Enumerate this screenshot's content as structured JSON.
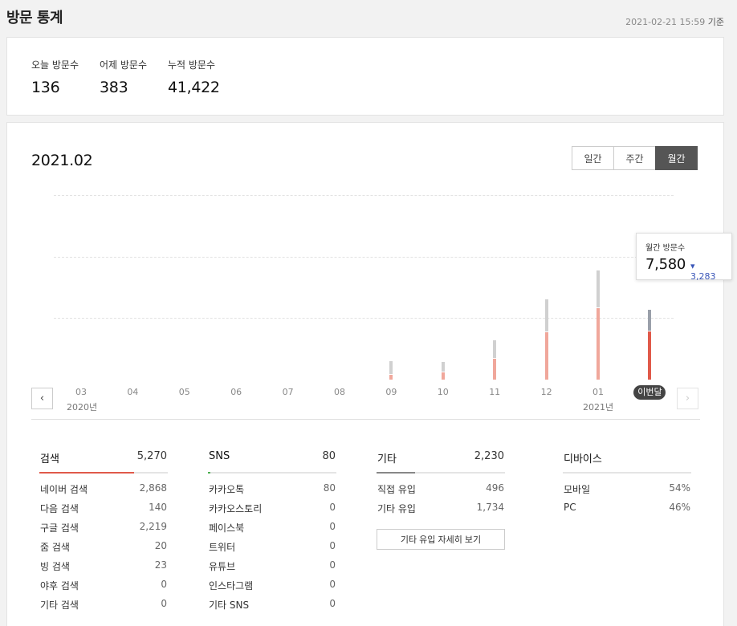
{
  "header": {
    "title": "방문 통계",
    "timestamp": "2021-02-21 15:59",
    "timestamp_suffix": "기준"
  },
  "summary": [
    {
      "label": "오늘 방문수",
      "value": "136"
    },
    {
      "label": "어제 방문수",
      "value": "383"
    },
    {
      "label": "누적 방문수",
      "value": "41,422"
    }
  ],
  "period": "2021.02",
  "tabs": [
    {
      "label": "일간"
    },
    {
      "label": "주간"
    },
    {
      "label": "월간",
      "active": true
    }
  ],
  "nav": {
    "prev": "‹",
    "next": "›"
  },
  "tooltip": {
    "label": "월간 방문수",
    "value": "7,580",
    "change": "3,283",
    "change_icon": "▾"
  },
  "year_labels": [
    "2020년",
    "2021년"
  ],
  "colors": {
    "new": "#f0a79b",
    "new_current": "#e05a4a",
    "prev": "#d0d0d0",
    "prev_current": "#9aa0aa",
    "search": "#e05a4a",
    "sns": "#4caf50",
    "etc": "#888888",
    "device": "#dddddd"
  },
  "chart_data": {
    "type": "bar",
    "categories": [
      "03",
      "04",
      "05",
      "06",
      "07",
      "08",
      "09",
      "10",
      "11",
      "12",
      "01",
      "이번달"
    ],
    "series": [
      {
        "values": [
          0,
          0,
          0,
          0,
          0,
          5,
          200,
          300,
          900,
          2050,
          3100,
          2100
        ]
      },
      {
        "values": [
          0,
          0,
          0,
          0,
          0,
          0,
          550,
          400,
          750,
          1400,
          1600,
          900
        ]
      }
    ],
    "ylim": [
      0,
      8000
    ],
    "grid": true
  },
  "stats": {
    "search": {
      "title": "검색",
      "total": "5,270",
      "share": 0.74,
      "rows": [
        {
          "label": "네이버 검색",
          "value": "2,868"
        },
        {
          "label": "다음 검색",
          "value": "140"
        },
        {
          "label": "구글 검색",
          "value": "2,219"
        },
        {
          "label": "줌 검색",
          "value": "20"
        },
        {
          "label": "빙 검색",
          "value": "23"
        },
        {
          "label": "야후 검색",
          "value": "0"
        },
        {
          "label": "기타 검색",
          "value": "0"
        }
      ]
    },
    "sns": {
      "title": "SNS",
      "total": "80",
      "share": 0.02,
      "rows": [
        {
          "label": "카카오톡",
          "value": "80"
        },
        {
          "label": "카카오스토리",
          "value": "0"
        },
        {
          "label": "페이스북",
          "value": "0"
        },
        {
          "label": "트위터",
          "value": "0"
        },
        {
          "label": "유튜브",
          "value": "0"
        },
        {
          "label": "인스타그램",
          "value": "0"
        },
        {
          "label": "기타 SNS",
          "value": "0"
        }
      ]
    },
    "etc": {
      "title": "기타",
      "total": "2,230",
      "share": 0.3,
      "rows": [
        {
          "label": "직접 유입",
          "value": "496"
        },
        {
          "label": "기타 유입",
          "value": "1,734"
        }
      ],
      "detail_button": "기타 유입 자세히 보기"
    },
    "device": {
      "title": "디바이스",
      "rows": [
        {
          "label": "모바일",
          "value": "54%"
        },
        {
          "label": "PC",
          "value": "46%"
        }
      ]
    }
  }
}
